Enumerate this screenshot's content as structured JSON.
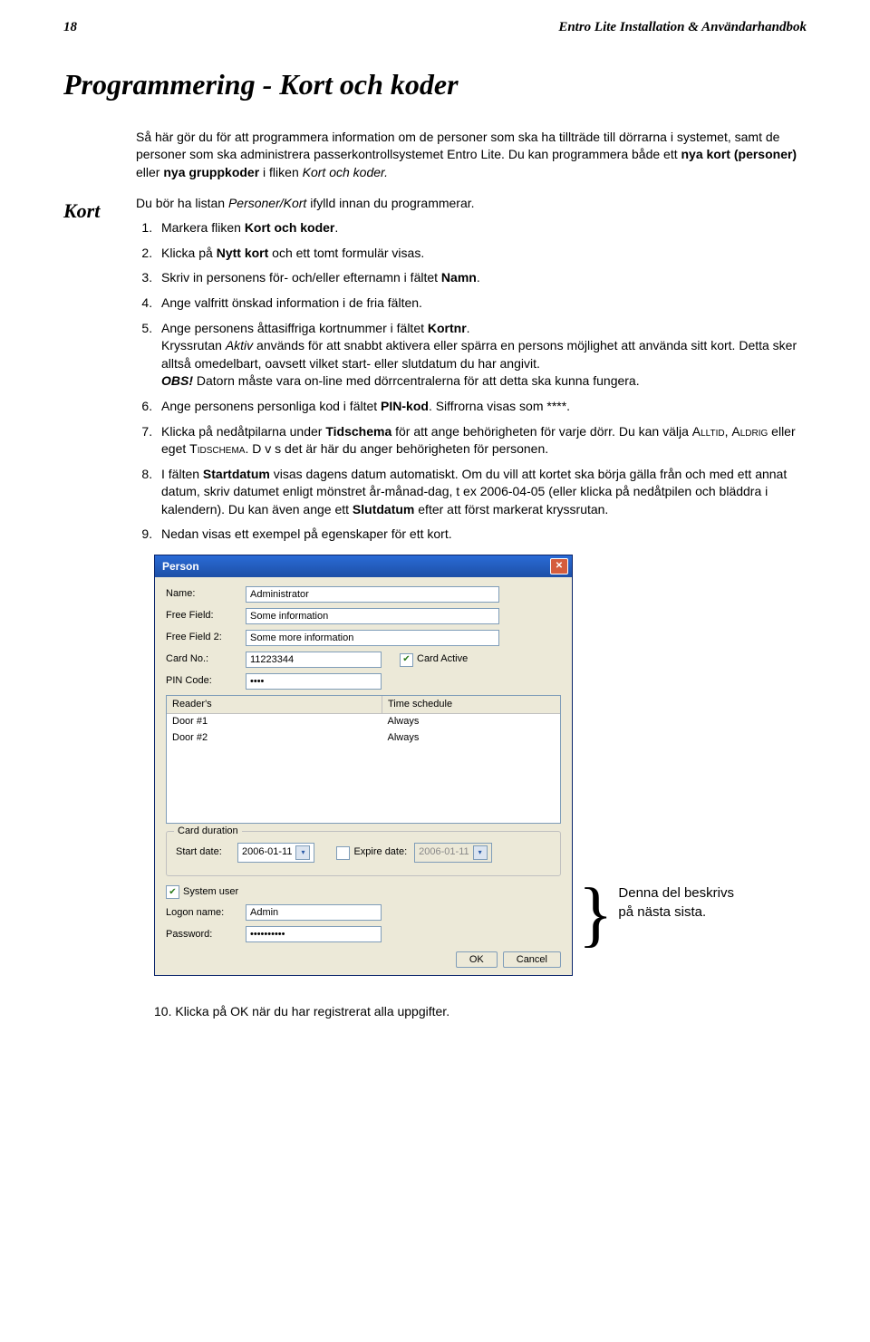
{
  "header": {
    "page_num": "18",
    "doc_title": "Entro Lite Installation & Användarhandbok"
  },
  "h1": "Programmering - Kort och koder",
  "sidebar": {
    "h2": "Kort"
  },
  "intro1_pre": "Så här gör du för att programmera information om de personer som ska ha tillträde till dörrarna i systemet, samt de personer som ska administrera passerkontrollsystemet Entro Lite. Du kan programmera både ett ",
  "intro1_b1": "nya kort (personer)",
  "intro1_mid": " eller ",
  "intro1_b2": "nya gruppkoder",
  "intro1_post": " i fliken ",
  "intro1_it": "Kort och koder.",
  "intro2_pre": "Du bör ha listan ",
  "intro2_it": "Personer/Kort",
  "intro2_post": " ifylld innan du programmerar.",
  "steps": {
    "s1a": "Markera fliken ",
    "s1b": "Kort och koder",
    "s1c": ".",
    "s2a": "Klicka på ",
    "s2b": "Nytt kort",
    "s2c": " och ett tomt formulär visas.",
    "s3a": "Skriv in personens för- och/eller efternamn i fältet ",
    "s3b": "Namn",
    "s3c": ".",
    "s4": "Ange valfritt önskad information i de fria fälten.",
    "s5a": "Ange personens åttasiffriga kortnummer i fältet ",
    "s5b": "Kortnr",
    "s5c": ".",
    "s5d_pre": "Kryssrutan ",
    "s5d_it": "Aktiv",
    "s5d_post": " används för att snabbt aktivera eller spärra en persons möjlighet att använda sitt kort. Detta sker alltså omedelbart, oavsett vilket start- eller slutdatum du har angivit.",
    "s5e_obs": "OBS!",
    "s5e_txt": " Datorn måste vara on-line med dörrcentralerna för att detta ska kunna fungera.",
    "s6a": "Ange personens personliga kod i fältet ",
    "s6b": "PIN-kod",
    "s6c": ". Siffrorna visas som ****.",
    "s7a": "Klicka på nedåtpilarna under ",
    "s7b": "Tidschema",
    "s7c": " för att ange behörigheten för varje dörr. Du kan välja ",
    "s7sc1": "Alltid",
    "s7mid1": ", ",
    "s7sc2": "Aldrig",
    "s7mid2": " eller eget ",
    "s7sc3": "Tidschema",
    "s7post": ". D v s det är här du anger behörigheten för personen.",
    "s8a": "I fälten ",
    "s8b": "Startdatum",
    "s8c": " visas dagens datum automatiskt. Om du vill att kortet ska börja gälla från och med ett annat datum, skriv datumet enligt mönstret år-månad-dag, t ex 2006-04-05 (eller klicka på nedåtpilen och bläddra i kalendern). Du kan även ange ett ",
    "s8d": "Slutdatum",
    "s8e": " efter att först markerat kryssrutan.",
    "s9": "Nedan visas ett exempel på egenskaper för ett kort."
  },
  "dialog": {
    "title": "Person",
    "lbl_name": "Name:",
    "val_name": "Administrator",
    "lbl_ff1": "Free Field:",
    "val_ff1": "Some information",
    "lbl_ff2": "Free Field 2:",
    "val_ff2": "Some more information",
    "lbl_card": "Card No.:",
    "val_card": "11223344",
    "chk_active": "Card Active",
    "lbl_pin": "PIN Code:",
    "val_pin": "••••",
    "col_reader": "Reader's",
    "col_sched": "Time schedule",
    "row1_r": "Door #1",
    "row1_s": "Always",
    "row2_r": "Door #2",
    "row2_s": "Always",
    "grp_title": "Card duration",
    "lbl_start": "Start date:",
    "val_start": "2006-01-11",
    "lbl_expire": "Expire date:",
    "val_expire": "2006-01-11",
    "chk_system": "System user",
    "lbl_logon": "Logon name:",
    "val_logon": "Admin",
    "lbl_pwd": "Password:",
    "val_pwd": "••••••••••",
    "btn_ok": "OK",
    "btn_cancel": "Cancel"
  },
  "note_l1": "Denna del beskrivs",
  "note_l2": "på nästa sista.",
  "final_pre": "10. Klicka på ",
  "final_b": "OK",
  "final_post": " när du har registrerat alla uppgifter."
}
